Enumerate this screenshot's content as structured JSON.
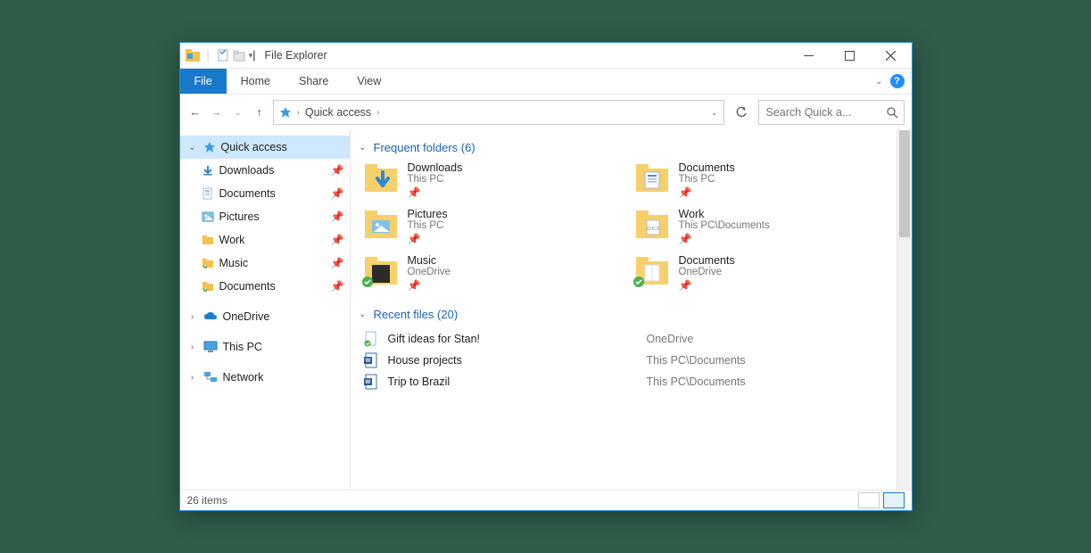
{
  "window": {
    "title": "File Explorer"
  },
  "ribbon": {
    "file": "File",
    "tabs": [
      "Home",
      "Share",
      "View"
    ]
  },
  "address": {
    "crumb": "Quick access",
    "search_placeholder": "Search Quick a..."
  },
  "sidebar": {
    "quick_access": {
      "label": "Quick access",
      "expanded": true
    },
    "qa_items": [
      {
        "label": "Downloads",
        "icon": "downloads"
      },
      {
        "label": "Documents",
        "icon": "documents"
      },
      {
        "label": "Pictures",
        "icon": "pictures"
      },
      {
        "label": "Work",
        "icon": "folder"
      },
      {
        "label": "Music",
        "icon": "music"
      },
      {
        "label": "Documents",
        "icon": "documents-green"
      }
    ],
    "roots": [
      {
        "label": "OneDrive",
        "icon": "onedrive"
      },
      {
        "label": "This PC",
        "icon": "thispc"
      },
      {
        "label": "Network",
        "icon": "network"
      }
    ]
  },
  "sections": {
    "frequent": {
      "title": "Frequent folders (6)"
    },
    "recent": {
      "title": "Recent files (20)"
    }
  },
  "frequent": [
    {
      "name": "Downloads",
      "loc": "This PC",
      "icon": "folder-dl"
    },
    {
      "name": "Documents",
      "loc": "This PC",
      "icon": "folder-doc"
    },
    {
      "name": "Pictures",
      "loc": "This PC",
      "icon": "folder-pic"
    },
    {
      "name": "Work",
      "loc": "This PC\\Documents",
      "icon": "folder-docx"
    },
    {
      "name": "Music",
      "loc": "OneDrive",
      "icon": "folder-music",
      "sync": true
    },
    {
      "name": "Documents",
      "loc": "OneDrive",
      "icon": "folder-plain",
      "sync": true
    }
  ],
  "recent": [
    {
      "name": "Gift ideas for Stan!",
      "loc": "OneDrive",
      "icon": "doc-sync"
    },
    {
      "name": "House projects",
      "loc": "This PC\\Documents",
      "icon": "doc-word"
    },
    {
      "name": "Trip to Brazil",
      "loc": "This PC\\Documents",
      "icon": "doc-word"
    }
  ],
  "status": {
    "items": "26 items"
  }
}
